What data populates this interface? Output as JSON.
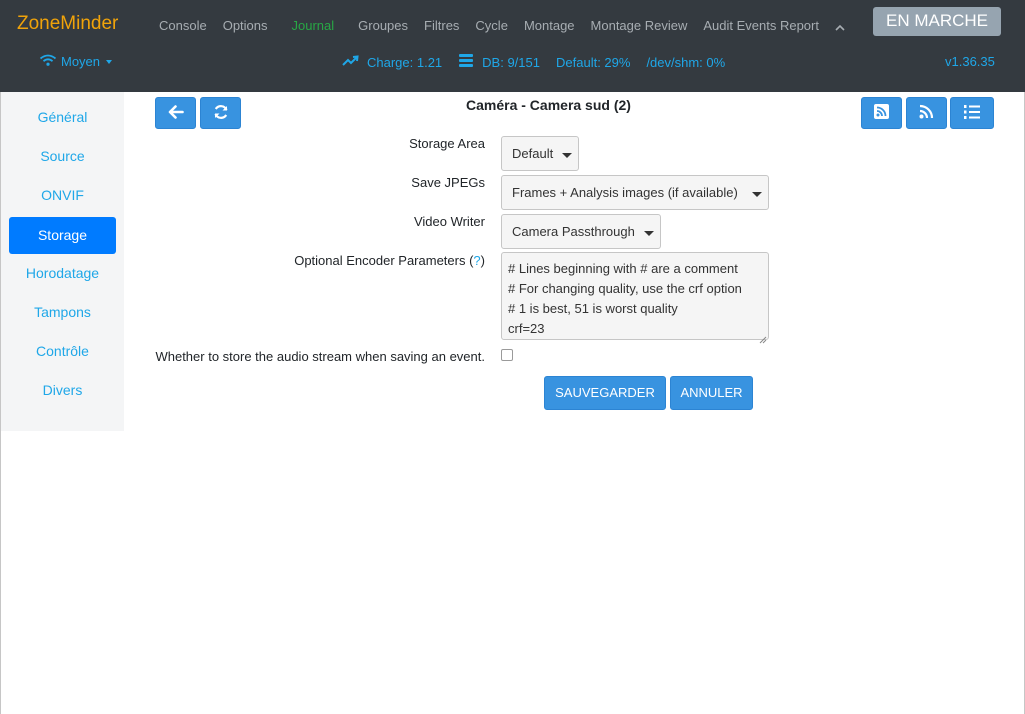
{
  "navbar": {
    "brand": "ZoneMinder",
    "links": [
      "Console",
      "Options",
      "Journal",
      "Groupes",
      "Filtres",
      "Cycle",
      "Montage",
      "Montage Review",
      "Audit Events Report"
    ],
    "active_link": "Journal",
    "collapse_icon": "chevron-up-icon",
    "state": "EN MARCHE"
  },
  "statusbar": {
    "bandwidth": "Moyen",
    "load": "Charge: 1.21",
    "db": "DB: 9/151",
    "default_storage": "Default: 29%",
    "shm": "/dev/shm: 0%",
    "version": "v1.36.35"
  },
  "sidebar": {
    "items": [
      {
        "label": "Général"
      },
      {
        "label": "Source"
      },
      {
        "label": "ONVIF"
      },
      {
        "label": "Storage"
      },
      {
        "label": "Horodatage"
      },
      {
        "label": "Tampons"
      },
      {
        "label": "Contrôle"
      },
      {
        "label": "Divers"
      }
    ],
    "active": "Storage"
  },
  "toolbar": {
    "back_icon": "arrow-left-icon",
    "refresh_icon": "refresh-icon",
    "right_icons": [
      "rss-square-icon",
      "rss-icon",
      "list-ordered-icon"
    ]
  },
  "page_title": "Caméra - Camera sud (2)",
  "form": {
    "storage_area": {
      "label": "Storage Area",
      "value": "Default"
    },
    "save_jpegs": {
      "label": "Save JPEGs",
      "value": "Frames + Analysis images (if available)"
    },
    "video_writer": {
      "label": "Video Writer",
      "value": "Camera Passthrough"
    },
    "encoder_params": {
      "label": "Optional Encoder Parameters (",
      "help": "?",
      "label_end": ")",
      "lines": [
        "# Lines beginning with # are a comment",
        "# For changing quality, use the crf option",
        "# 1 is best, 51 is worst quality",
        "crf=23"
      ]
    },
    "audio": {
      "label": "Whether to store the audio stream when saving an event.",
      "checked": false
    },
    "save_button": "SAUVEGARDER",
    "cancel_button": "ANNULER"
  }
}
